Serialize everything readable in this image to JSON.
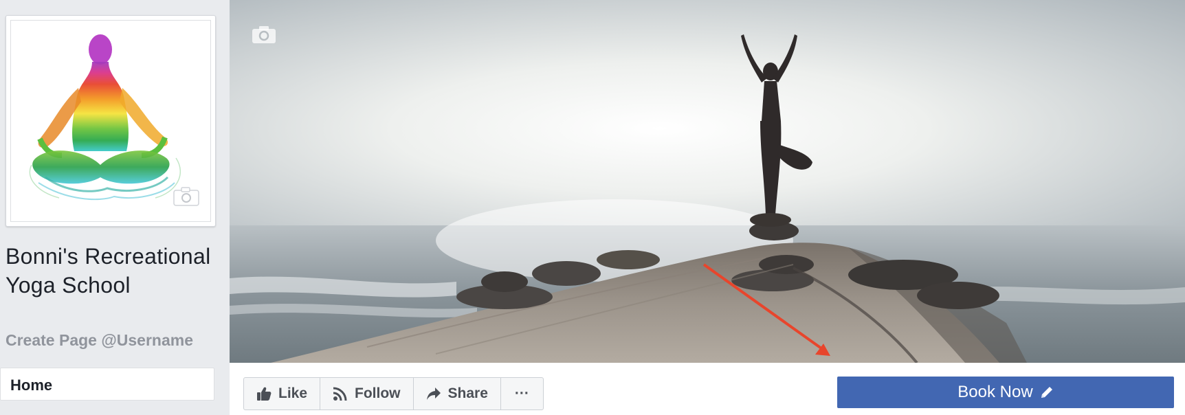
{
  "page": {
    "title": "Bonni's Recreational Yoga School",
    "username_link": "Create Page @Username"
  },
  "nav": {
    "home_label": "Home"
  },
  "actions": {
    "like_label": "Like",
    "follow_label": "Follow",
    "share_label": "Share",
    "more_label": "···",
    "book_label": "Book Now"
  },
  "icons": {
    "profile_camera": "camera-icon",
    "cover_camera": "camera-icon",
    "like": "thumbs-up-icon",
    "follow": "rss-icon",
    "share": "share-arrow-icon",
    "book_edit": "pencil-icon"
  },
  "colors": {
    "cta": "#4267b2",
    "background": "#e9ebee",
    "annotation_arrow": "#e8452c"
  }
}
